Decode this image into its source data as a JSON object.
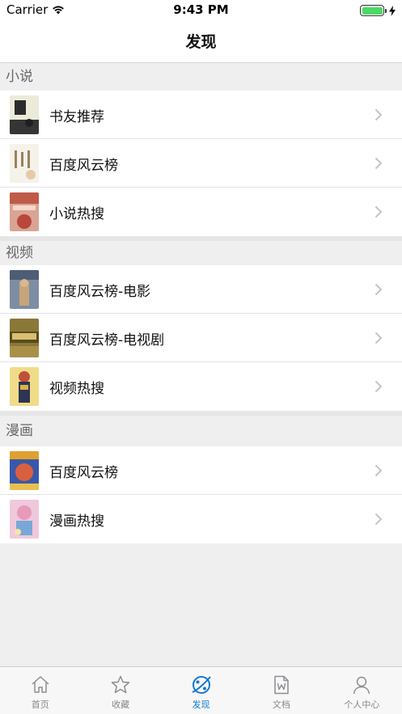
{
  "status_bar": {
    "carrier": "Carrier",
    "time": "9:43 PM",
    "battery_color": "#4cd964"
  },
  "nav": {
    "title": "发现"
  },
  "sections": [
    {
      "title": "小说",
      "items": [
        {
          "label": "书友推荐",
          "thumb_colors": [
            "#e8e4d8",
            "#2a2a2a"
          ]
        },
        {
          "label": "百度风云榜",
          "thumb_colors": [
            "#f3efe6",
            "#c9a98a"
          ]
        },
        {
          "label": "小说热搜",
          "thumb_colors": [
            "#d8b0a0",
            "#b84c3c"
          ]
        }
      ]
    },
    {
      "title": "视频",
      "items": [
        {
          "label": "百度风云榜-电影",
          "thumb_colors": [
            "#6a7a90",
            "#b89a70"
          ]
        },
        {
          "label": "百度风云榜-电视剧",
          "thumb_colors": [
            "#7a6a30",
            "#c8b060"
          ]
        },
        {
          "label": "视频热搜",
          "thumb_colors": [
            "#e8d070",
            "#2a3050"
          ]
        }
      ]
    },
    {
      "title": "漫画",
      "items": [
        {
          "label": "百度风云榜",
          "thumb_colors": [
            "#d86040",
            "#3050a0"
          ]
        },
        {
          "label": "漫画热搜",
          "thumb_colors": [
            "#e8b8d0",
            "#70a0d0"
          ]
        }
      ]
    }
  ],
  "tabs": [
    {
      "label": "首页",
      "icon": "home-icon",
      "active": false
    },
    {
      "label": "收藏",
      "icon": "star-icon",
      "active": false
    },
    {
      "label": "发现",
      "icon": "discover-icon",
      "active": true
    },
    {
      "label": "文档",
      "icon": "document-icon",
      "active": false
    },
    {
      "label": "个人中心",
      "icon": "person-icon",
      "active": false
    }
  ],
  "colors": {
    "accent": "#1479d3",
    "inactive": "#888888"
  }
}
